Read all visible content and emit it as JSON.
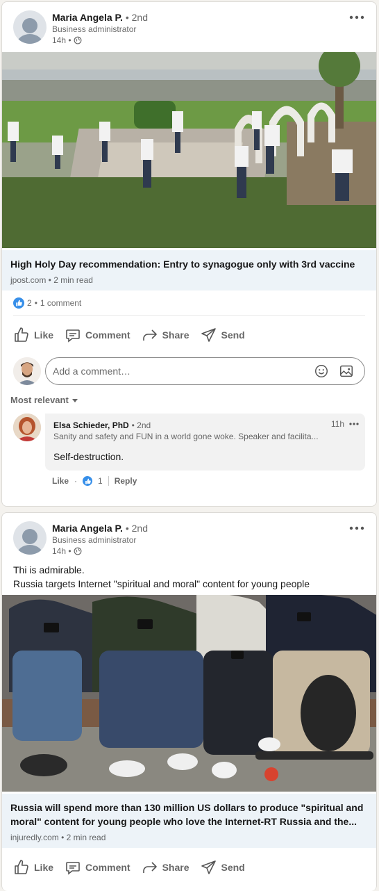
{
  "posts": [
    {
      "author": {
        "name": "Maria Angela P.",
        "degree": "• 2nd",
        "headline": "Business administrator",
        "time": "14h •",
        "visibility_icon": "globe-icon"
      },
      "text_lines": [],
      "image_icon": "outdoor-prayer-photo",
      "link": {
        "title": "High Holy Day recommendation: Entry to synagogue only with 3rd vaccine",
        "meta": "jpost.com • 2 min read"
      },
      "social": {
        "reactions": "2",
        "separator": "•",
        "comments": "1 comment"
      },
      "actions": {
        "like": "Like",
        "comment": "Comment",
        "share": "Share",
        "send": "Send"
      },
      "comment_box": {
        "placeholder": "Add a comment…"
      },
      "sort_label": "Most relevant",
      "comments": [
        {
          "name": "Elsa Schieder, PhD",
          "degree": "• 2nd",
          "headline": "Sanity and safety and FUN in a world gone woke. Speaker and facilita...",
          "time": "11h",
          "body": "Self-destruction.",
          "like_label": "Like",
          "dot": "·",
          "reaction_count": "1",
          "reply_label": "Reply"
        }
      ]
    },
    {
      "author": {
        "name": "Maria Angela P.",
        "degree": "• 2nd",
        "headline": "Business administrator",
        "time": "14h •",
        "visibility_icon": "globe-icon"
      },
      "text_lines": [
        "Thi is admirable.",
        "Russia targets Internet \"spiritual and moral\" content for young people"
      ],
      "image_icon": "young-people-phones-photo",
      "link": {
        "title": "Russia will spend more than 130 million US dollars to produce \"spiritual and moral\" content for young people who love the Internet-RT Russia and the...",
        "meta": "injuredly.com • 2 min read"
      },
      "actions": {
        "like": "Like",
        "comment": "Comment",
        "share": "Share",
        "send": "Send"
      }
    }
  ],
  "colors": {
    "link_bg": "#edf3f8",
    "like_blue": "#378fe9",
    "page_bg": "#f4f2ee"
  }
}
